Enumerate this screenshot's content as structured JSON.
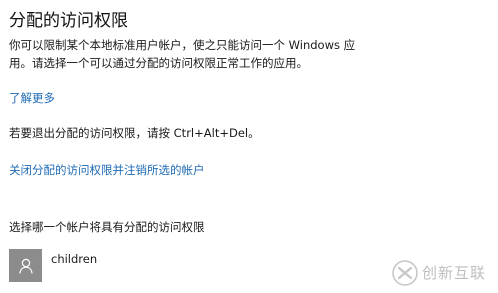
{
  "title": "分配的访问权限",
  "description": {
    "line1": "你可以限制某个本地标准用户帐户，使之只能访问一个 Windows 应",
    "line2": "用。请选择一个可以通过分配的访问权限正常工作的应用。"
  },
  "learn_more_link": "了解更多",
  "exit_instruction": "若要退出分配的访问权限，请按 Ctrl+Alt+Del。",
  "close_access_link": "关闭分配的访问权限并注销所选的帐户",
  "choose_account_label": "选择哪一个帐户将具有分配的访问权限",
  "selected_account": {
    "name": "children",
    "avatar_icon": "user-icon"
  },
  "watermark": {
    "text": "创新互联",
    "icon": "brand-logo-icon"
  },
  "colors": {
    "link": "#1f6bb5",
    "avatar_bg": "#8c8c8c",
    "text": "#1a1a1a",
    "background": "#ffffff"
  }
}
